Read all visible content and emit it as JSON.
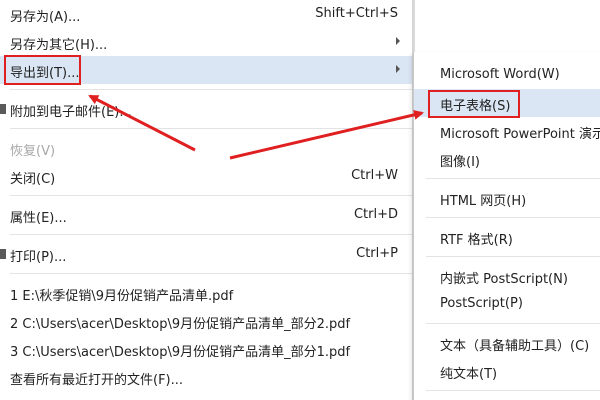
{
  "main_menu": {
    "save_as": {
      "label": "另存为(A)...",
      "shortcut": "Shift+Ctrl+S"
    },
    "save_as_other": {
      "label": "另存为其它(H)..."
    },
    "export_to": {
      "label": "导出到(T)..."
    },
    "attach_email": {
      "label": "附加到电子邮件(E)..."
    },
    "restore": {
      "label": "恢复(V)"
    },
    "close": {
      "label": "关闭(C)",
      "shortcut": "Ctrl+W"
    },
    "properties": {
      "label": "属性(E)...",
      "shortcut": "Ctrl+D"
    },
    "print": {
      "label": "打印(P)...",
      "shortcut": "Ctrl+P"
    },
    "recent": [
      "1 E:\\秋季促销\\9月份促销产品清单.pdf",
      "2 C:\\Users\\acer\\Desktop\\9月份促销产品清单_部分2.pdf",
      "3 C:\\Users\\acer\\Desktop\\9月份促销产品清单_部分1.pdf"
    ],
    "view_all_recent": {
      "label": "查看所有最近打开的文件(F)..."
    }
  },
  "export_submenu": {
    "items": [
      "Microsoft Word(W)",
      "电子表格(S)",
      "Microsoft PowerPoint 演示",
      "图像(I)",
      "HTML 网页(H)",
      "RTF 格式(R)",
      "内嵌式 PostScript(N)",
      "PostScript(P)",
      "文本（具备辅助工具）(C)",
      "纯文本(T)"
    ]
  },
  "annotation_color": "#e02020",
  "highlight_color": "#dbe6f4"
}
